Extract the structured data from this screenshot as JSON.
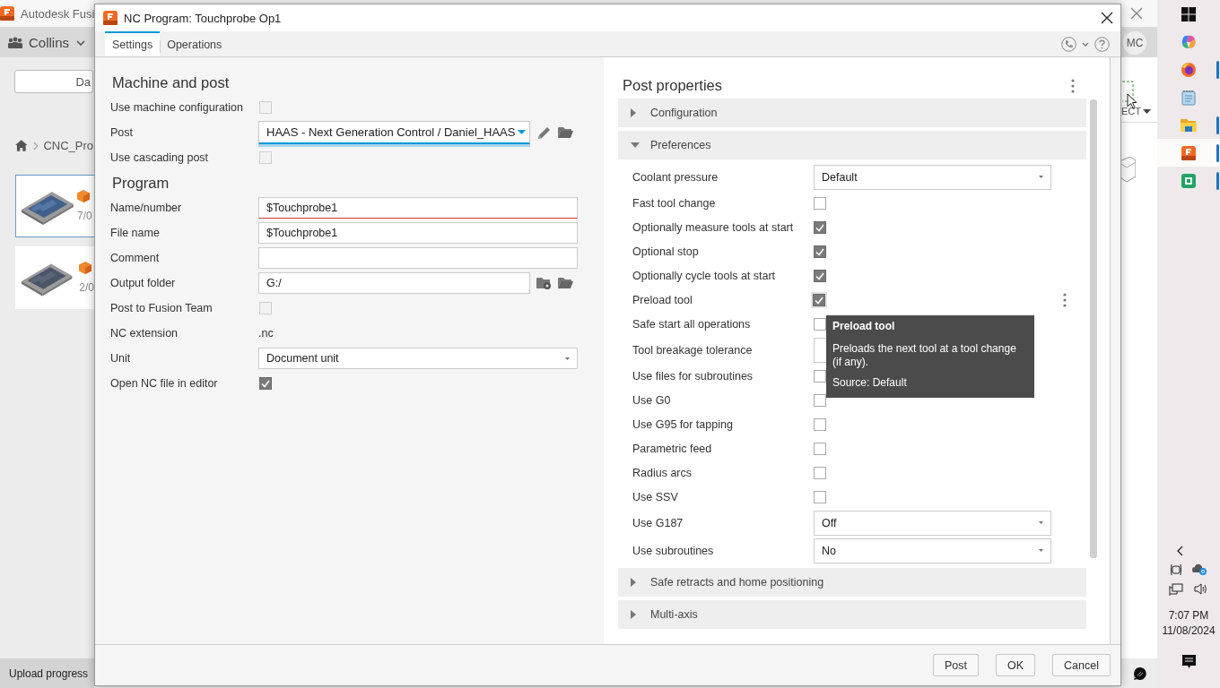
{
  "background": {
    "title": "Autodesk Fusi",
    "team": "Collins",
    "avatar": "MC",
    "button": "Da",
    "breadcrumb": "CNC_Pro",
    "select_menu": "ECT",
    "status": "Upload progress",
    "files": [
      {
        "date": "7/0",
        "selected": true
      },
      {
        "date": "2/0",
        "selected": false
      }
    ]
  },
  "dialog": {
    "title": "NC Program: Touchprobe Op1",
    "tabs": [
      {
        "label": "Settings",
        "selected": true
      },
      {
        "label": "Operations",
        "selected": false
      }
    ],
    "settings": [
      {
        "heading": "Machine and post",
        "rows": [
          {
            "label": "Use machine configuration",
            "kind": "checkbox",
            "checked": false
          },
          {
            "label": "Post",
            "kind": "post",
            "value": "HAAS - Next Generation Control / Daniel_HAAS",
            "focused": true
          },
          {
            "label": "Use cascading post",
            "kind": "checkbox",
            "checked": false
          }
        ]
      },
      {
        "heading": "Program",
        "rows": [
          {
            "label": "Name/number",
            "kind": "text",
            "value": "$Touchprobe1",
            "invalid": true
          },
          {
            "label": "File name",
            "kind": "text",
            "value": "$Touchprobe1",
            "invalid": false
          },
          {
            "label": "Comment",
            "kind": "text",
            "value": "",
            "invalid": false
          },
          {
            "label": "Output folder",
            "kind": "folder",
            "value": "G:/"
          },
          {
            "label": "Post to Fusion Team",
            "kind": "checkbox",
            "checked": false
          },
          {
            "label": "NC extension",
            "kind": "static",
            "value": ".nc"
          },
          {
            "label": "Unit",
            "kind": "dropdown",
            "value": "Document unit"
          },
          {
            "label": "Open NC file in editor",
            "kind": "checkbox",
            "checked": true
          }
        ]
      }
    ],
    "post_properties": {
      "title": "Post properties",
      "sections": [
        {
          "label": "Configuration",
          "expanded": false
        },
        {
          "label": "Preferences",
          "expanded": true,
          "rows": [
            {
              "label": "Coolant pressure",
              "kind": "dropdown",
              "value": "Default",
              "hovered": false
            },
            {
              "label": "Fast tool change",
              "kind": "checkbox",
              "checked": false,
              "hovered": false
            },
            {
              "label": "Optionally measure tools at start",
              "kind": "checkbox",
              "checked": true,
              "hovered": false
            },
            {
              "label": "Optional stop",
              "kind": "checkbox",
              "checked": true,
              "hovered": false
            },
            {
              "label": "Optionally cycle tools at start",
              "kind": "checkbox",
              "checked": true,
              "hovered": false
            },
            {
              "label": "Preload tool",
              "kind": "checkbox",
              "checked": true,
              "hovered": true
            },
            {
              "label": "Safe start all operations",
              "kind": "checkbox",
              "checked": false,
              "hovered": false
            },
            {
              "label": "Tool breakage tolerance",
              "kind": "text",
              "hovered": false
            },
            {
              "label": "Use files for subroutines",
              "kind": "checkbox",
              "checked": false,
              "hovered": false
            },
            {
              "label": "Use G0",
              "kind": "checkbox",
              "checked": false,
              "hovered": false
            },
            {
              "label": "Use G95 for tapping",
              "kind": "checkbox",
              "checked": false,
              "hovered": false
            },
            {
              "label": "Parametric feed",
              "kind": "checkbox",
              "checked": false,
              "hovered": false
            },
            {
              "label": "Radius arcs",
              "kind": "checkbox",
              "checked": false,
              "hovered": false
            },
            {
              "label": "Use SSV",
              "kind": "checkbox",
              "checked": false,
              "hovered": false
            },
            {
              "label": "Use G187",
              "kind": "dropdown",
              "value": "Off",
              "hovered": false
            },
            {
              "label": "Use subroutines",
              "kind": "dropdown",
              "value": "No",
              "hovered": false
            }
          ]
        },
        {
          "label": "Safe retracts and home positioning",
          "expanded": false
        },
        {
          "label": "Multi-axis",
          "expanded": false
        }
      ]
    },
    "tooltip": {
      "title": "Preload tool",
      "text": "Preloads the next tool at a tool change (if any).",
      "source": "Source: Default"
    },
    "buttons": [
      "Post",
      "OK",
      "Cancel"
    ]
  },
  "taskbar": {
    "apps": [
      {
        "kind": "start",
        "running": false,
        "selected": false
      },
      {
        "kind": "copilot",
        "running": false,
        "selected": false
      },
      {
        "kind": "firefox",
        "running": true,
        "selected": false
      },
      {
        "kind": "notepad",
        "running": false,
        "selected": false
      },
      {
        "kind": "explorer",
        "running": true,
        "selected": false
      },
      {
        "kind": "fusion",
        "running": true,
        "selected": true
      },
      {
        "kind": "green",
        "running": true,
        "selected": false
      }
    ],
    "time": "7:07 PM",
    "date": "11/08/2024"
  }
}
